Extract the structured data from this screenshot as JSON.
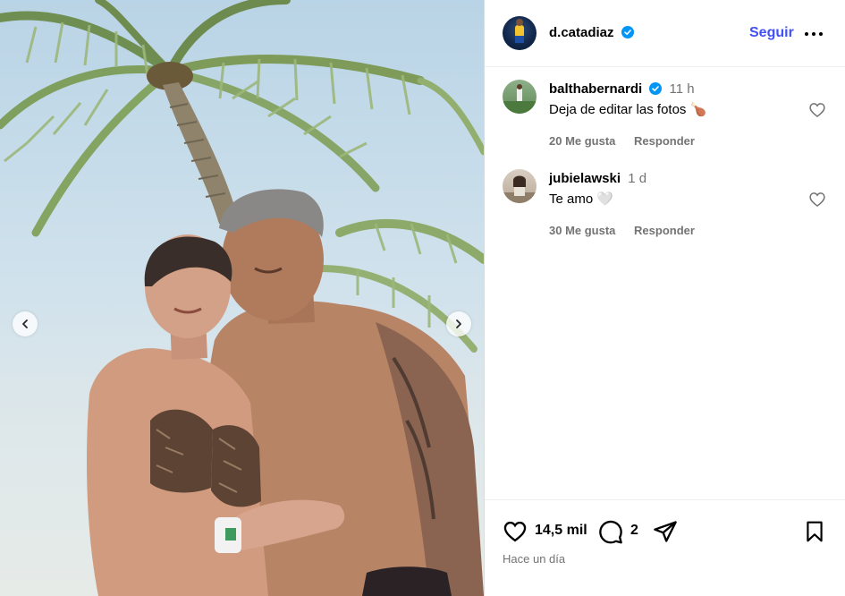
{
  "post": {
    "author": "d.catadiaz",
    "follow_label": "Seguir",
    "more_label": "…"
  },
  "comments": [
    {
      "username": "balthabernardi",
      "time": "11 h",
      "text": "Deja de editar las fotos 🍗",
      "likes": "20 Me gusta",
      "reply": "Responder"
    },
    {
      "username": "jubielawski",
      "time": "1 d",
      "text": "Te amo 🤍",
      "likes": "30 Me gusta",
      "reply": "Responder"
    }
  ],
  "actions": {
    "like_count": "14,5 mil",
    "comment_count": "2",
    "time_ago": "Hace un día"
  },
  "colors": {
    "accent_blue": "#4150f7",
    "verified_blue": "#0095f6",
    "muted_text": "#737373"
  },
  "icons": [
    "chevron-left-icon",
    "chevron-right-icon",
    "verified-icon",
    "more-icon",
    "heart-icon",
    "comment-icon",
    "share-icon",
    "bookmark-icon"
  ]
}
